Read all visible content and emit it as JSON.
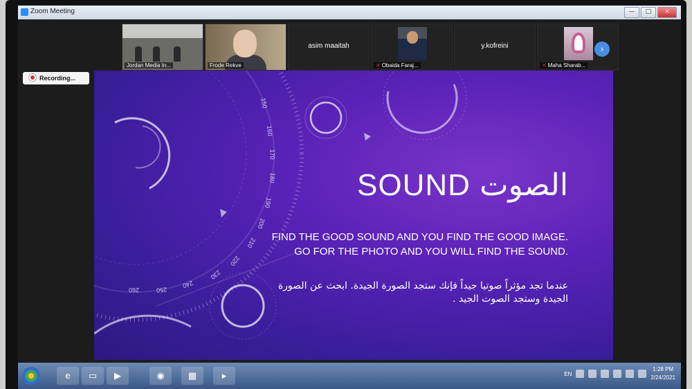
{
  "window": {
    "title": "Zoom Meeting",
    "minimize": "—",
    "maximize": "□",
    "close": "×"
  },
  "participants": [
    {
      "name": "Jordan Media In...",
      "type": "video"
    },
    {
      "name": "Frode Rekve",
      "type": "video"
    },
    {
      "name": "asim maaitah",
      "type": "name-only"
    },
    {
      "name": "Obaida Faraj...",
      "type": "thumbnail",
      "muted": true
    },
    {
      "name": "y.kofreini",
      "type": "name-only"
    },
    {
      "name": "Maha Sharab...",
      "type": "thumbnail",
      "muted": true
    }
  ],
  "participant_strip": {
    "next_icon": "chevron-right-icon",
    "next_glyph": "›"
  },
  "recording": {
    "label": "Recording..."
  },
  "slide": {
    "title": "SOUND الصوت",
    "body_en": "FIND THE GOOD SOUND AND YOU FIND THE GOOD IMAGE. GO FOR THE PHOTO AND YOU WILL FIND THE SOUND.",
    "body_ar": "عندما تجد مؤثراً صوتيا جيداً فإنك ستجد الصورة الجيدة. ابحث عن الصورة الجيدة وستجد الصوت الجيد .",
    "dial_numbers": [
      "150",
      "160",
      "170",
      "180",
      "190",
      "200",
      "210",
      "220",
      "230",
      "240",
      "250",
      "260"
    ]
  },
  "taskbar": {
    "language": "EN",
    "time": "1:28 PM",
    "date": "2/24/2021",
    "apps": [
      "internet-explorer-icon",
      "folder-icon",
      "media-player-icon",
      "chrome-icon",
      "app-icon",
      "zoom-icon"
    ]
  },
  "colors": {
    "slide_purple": "#5a22b8",
    "taskbar_blue": "#3a5786",
    "zoom_blue": "#2d8cff"
  }
}
